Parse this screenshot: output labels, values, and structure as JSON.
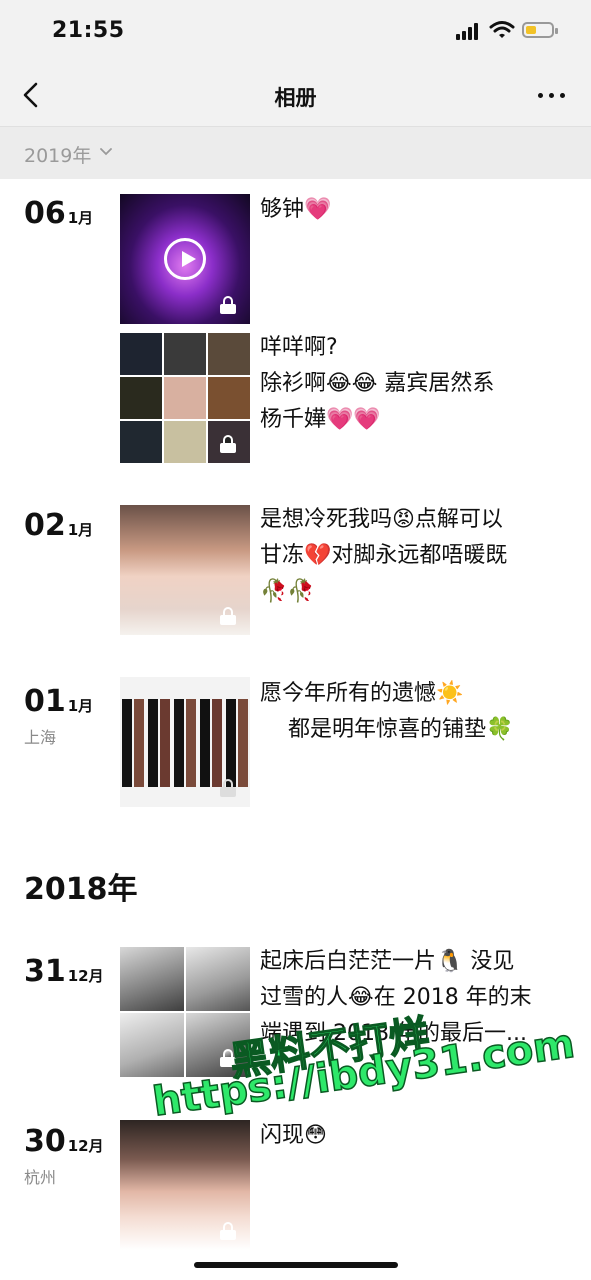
{
  "status_bar": {
    "time": "21:55"
  },
  "nav": {
    "title": "相册"
  },
  "filter": {
    "year_label": "2019年"
  },
  "posts_2019": [
    {
      "day": "06",
      "month": "1月",
      "location": "",
      "captions": [
        {
          "lines": [
            "够钟💗"
          ]
        },
        {
          "lines": [
            "咩咩啊?",
            "除衫啊😂😂 嘉宾居然系",
            "杨千嬅💗💗"
          ]
        }
      ]
    },
    {
      "day": "02",
      "month": "1月",
      "location": "",
      "captions": [
        {
          "lines": [
            "是想冷死我吗😡点解可以",
            "甘冻💔对脚永远都唔暖既",
            "🥀🥀"
          ]
        }
      ]
    },
    {
      "day": "01",
      "month": "1月",
      "location": "上海",
      "captions": [
        {
          "lines": [
            "愿今年所有的遗憾☀️",
            "    都是明年惊喜的铺垫🍀"
          ]
        }
      ]
    }
  ],
  "year_2018": {
    "label": "2018年"
  },
  "posts_2018": [
    {
      "day": "31",
      "month": "12月",
      "location": "",
      "captions": [
        {
          "lines": [
            "起床后白茫茫一片🐧 没见",
            "过雪的人😂在 2018 年的末",
            "端遇到 2018 年的最后一..."
          ]
        }
      ]
    },
    {
      "day": "30",
      "month": "12月",
      "location": "杭州",
      "captions": [
        {
          "lines": [
            "闪现😳"
          ]
        }
      ]
    }
  ],
  "watermark": {
    "line1": "黑料不打烊",
    "line2": "https://ibdy31.com"
  },
  "colors": {
    "bar_bg": "#f2f2f2",
    "filter_bg": "#ececec",
    "watermark": "#2ee86a"
  }
}
